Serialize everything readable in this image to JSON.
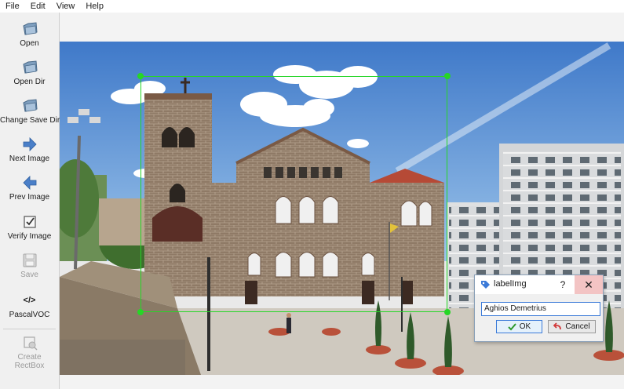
{
  "menu": [
    "File",
    "Edit",
    "View",
    "Help"
  ],
  "toolbar": {
    "open": "Open",
    "open_dir": "Open Dir",
    "change_save_dir": "Change Save Dir",
    "next_image": "Next Image",
    "prev_image": "Prev Image",
    "verify_image": "Verify Image",
    "save": "Save",
    "format_glyph": "</>",
    "format": "PascalVOC",
    "create_rectbox": "Create\nRectBox"
  },
  "dialog": {
    "title": "labelImg",
    "help": "?",
    "close": "✕",
    "input_value": "Aghios Demetrius",
    "ok_label": "OK",
    "cancel_label": "Cancel"
  },
  "colors": {
    "bbox": "#26d626",
    "accent": "#3b7ad8",
    "folder_icon": "#5a7fa6"
  }
}
